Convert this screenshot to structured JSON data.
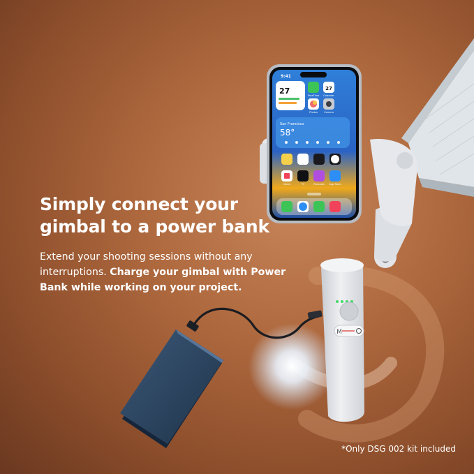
{
  "headline": {
    "line1": "Simply connect your",
    "line2": "gimbal to a power bank"
  },
  "body": {
    "intro": "Extend your shooting sessions without any interruptions. ",
    "emphasis": "Charge your gimbal with Power Bank while working on your project."
  },
  "footnote": "*Only DSG 002  kit included",
  "phone_screen": {
    "time": "9:41",
    "calendar_day": "27",
    "weather_city": "San Francisco",
    "weather_temp": "58°",
    "app_facetime": "FaceTime",
    "app_calendar": "Calendar",
    "app_photos": "Photos",
    "app_camera": "Camera",
    "app_tv": "TV",
    "app_podcasts": "Podcasts",
    "app_appstore": "App Store",
    "app_news": "News"
  },
  "gimbal_buttons": {
    "mode_label": "M"
  },
  "colors": {
    "background": "#b06a3f",
    "text": "#ffffff",
    "gimbal_body": "#e6e7ea",
    "power_bank": "#2c4560",
    "led": "#44d86a"
  }
}
